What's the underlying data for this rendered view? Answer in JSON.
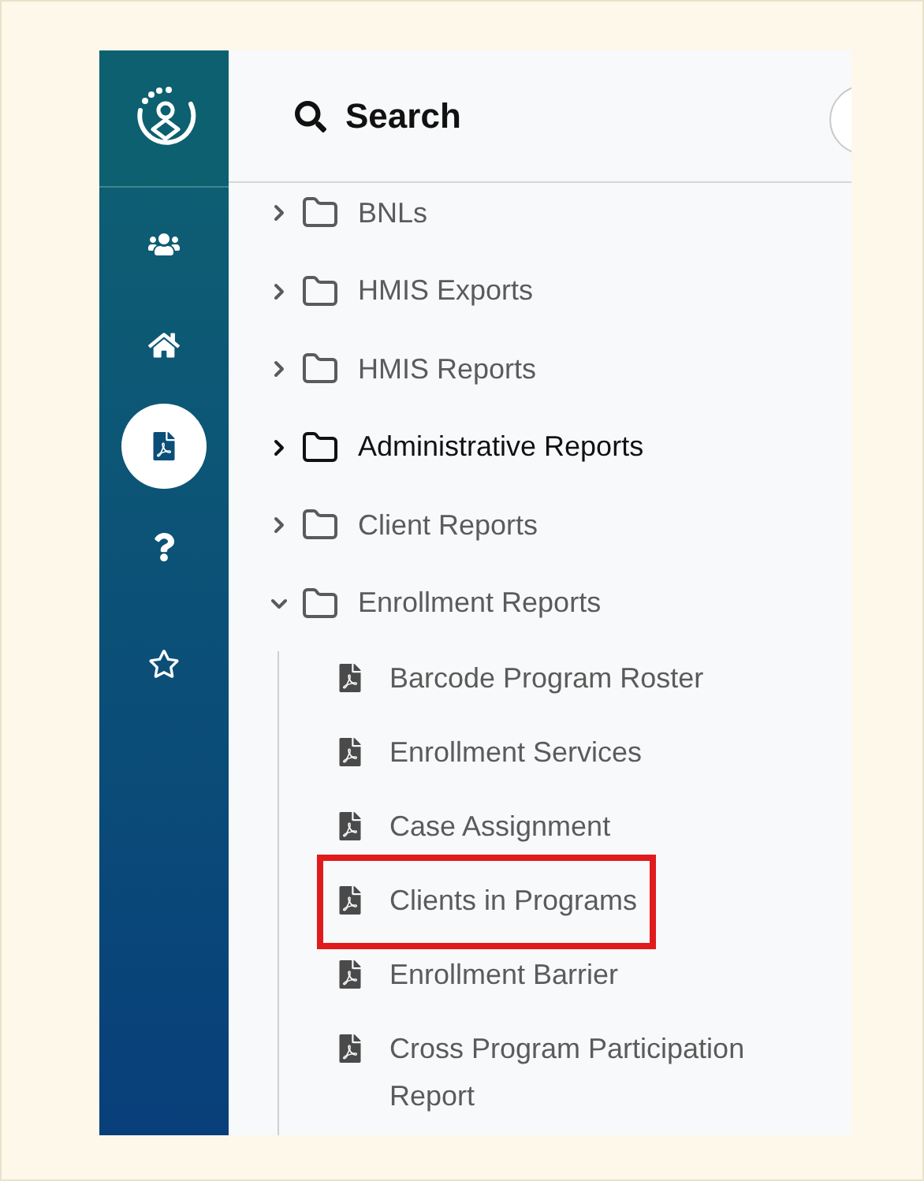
{
  "sidebar": {
    "items": [
      {
        "kind": "users",
        "selected": false
      },
      {
        "kind": "home",
        "selected": false
      },
      {
        "kind": "report",
        "selected": true
      },
      {
        "kind": "help",
        "selected": false
      },
      {
        "kind": "favorites",
        "selected": false
      }
    ]
  },
  "header": {
    "title": "Search"
  },
  "tree": [
    {
      "label": "BNLs",
      "expanded": false,
      "highlighted": false
    },
    {
      "label": "HMIS Exports",
      "expanded": false,
      "highlighted": false
    },
    {
      "label": "HMIS Reports",
      "expanded": false,
      "highlighted": false
    },
    {
      "label": "Administrative Reports",
      "expanded": false,
      "highlighted": true
    },
    {
      "label": "Client Reports",
      "expanded": false,
      "highlighted": false
    },
    {
      "label": "Enrollment Reports",
      "expanded": true,
      "highlighted": false,
      "children": [
        {
          "label": "Barcode Program Roster",
          "marked": false
        },
        {
          "label": "Enrollment Services",
          "marked": false
        },
        {
          "label": "Case Assignment",
          "marked": false
        },
        {
          "label": "Clients in Programs",
          "marked": true
        },
        {
          "label": "Enrollment Barrier",
          "marked": false
        },
        {
          "label": "Cross Program Participation Report",
          "marked": false
        }
      ]
    }
  ]
}
